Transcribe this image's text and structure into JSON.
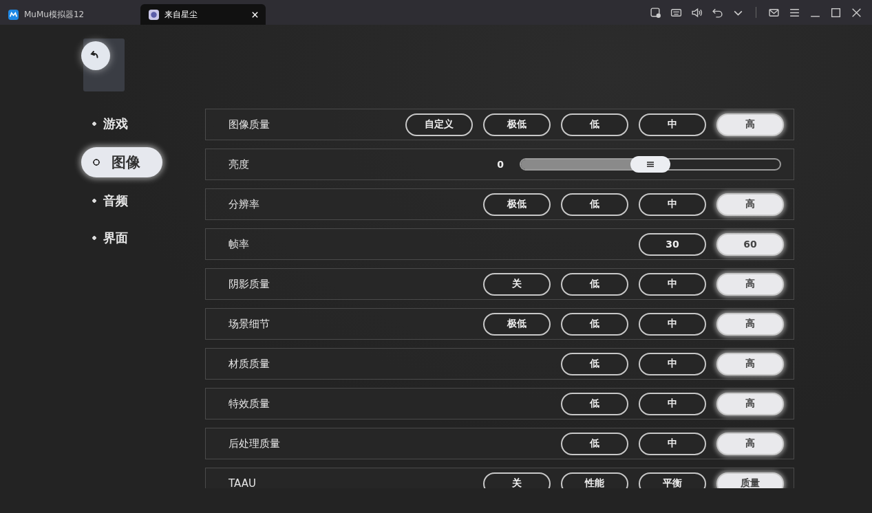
{
  "tabs": [
    {
      "label": "MuMu模拟器12",
      "selected": false,
      "kind": "app"
    },
    {
      "label": "来自星尘",
      "selected": true,
      "kind": "game",
      "closable": true
    }
  ],
  "sidebar": {
    "items": [
      {
        "label": "游戏",
        "selected": false
      },
      {
        "label": "图像",
        "selected": true
      },
      {
        "label": "音频",
        "selected": false
      },
      {
        "label": "界面",
        "selected": false
      }
    ]
  },
  "settings": [
    {
      "kind": "options",
      "label": "图像质量",
      "options": [
        {
          "label": "自定义",
          "selected": false
        },
        {
          "label": "极低",
          "selected": false
        },
        {
          "label": "低",
          "selected": false
        },
        {
          "label": "中",
          "selected": false
        },
        {
          "label": "高",
          "selected": true
        }
      ]
    },
    {
      "kind": "slider",
      "label": "亮度",
      "reading": "0",
      "level": 0.5
    },
    {
      "kind": "options",
      "label": "分辨率",
      "options": [
        {
          "label": "极低",
          "selected": false
        },
        {
          "label": "低",
          "selected": false
        },
        {
          "label": "中",
          "selected": false
        },
        {
          "label": "高",
          "selected": true
        }
      ]
    },
    {
      "kind": "options",
      "label": "帧率",
      "options": [
        {
          "label": "30",
          "selected": false
        },
        {
          "label": "60",
          "selected": true
        }
      ]
    },
    {
      "kind": "options",
      "label": "阴影质量",
      "options": [
        {
          "label": "关",
          "selected": false
        },
        {
          "label": "低",
          "selected": false
        },
        {
          "label": "中",
          "selected": false
        },
        {
          "label": "高",
          "selected": true
        }
      ]
    },
    {
      "kind": "options",
      "label": "场景细节",
      "options": [
        {
          "label": "极低",
          "selected": false
        },
        {
          "label": "低",
          "selected": false
        },
        {
          "label": "中",
          "selected": false
        },
        {
          "label": "高",
          "selected": true
        }
      ]
    },
    {
      "kind": "options",
      "label": "材质质量",
      "options": [
        {
          "label": "低",
          "selected": false
        },
        {
          "label": "中",
          "selected": false
        },
        {
          "label": "高",
          "selected": true
        }
      ]
    },
    {
      "kind": "options",
      "label": "特效质量",
      "options": [
        {
          "label": "低",
          "selected": false
        },
        {
          "label": "中",
          "selected": false
        },
        {
          "label": "高",
          "selected": true
        }
      ]
    },
    {
      "kind": "options",
      "label": "后处理质量",
      "options": [
        {
          "label": "低",
          "selected": false
        },
        {
          "label": "中",
          "selected": false
        },
        {
          "label": "高",
          "selected": true
        }
      ]
    },
    {
      "kind": "options",
      "label": "TAAU",
      "options": [
        {
          "label": "关",
          "selected": false
        },
        {
          "label": "性能",
          "selected": false
        },
        {
          "label": "平衡",
          "selected": false
        },
        {
          "label": "质量",
          "selected": true
        }
      ]
    }
  ]
}
